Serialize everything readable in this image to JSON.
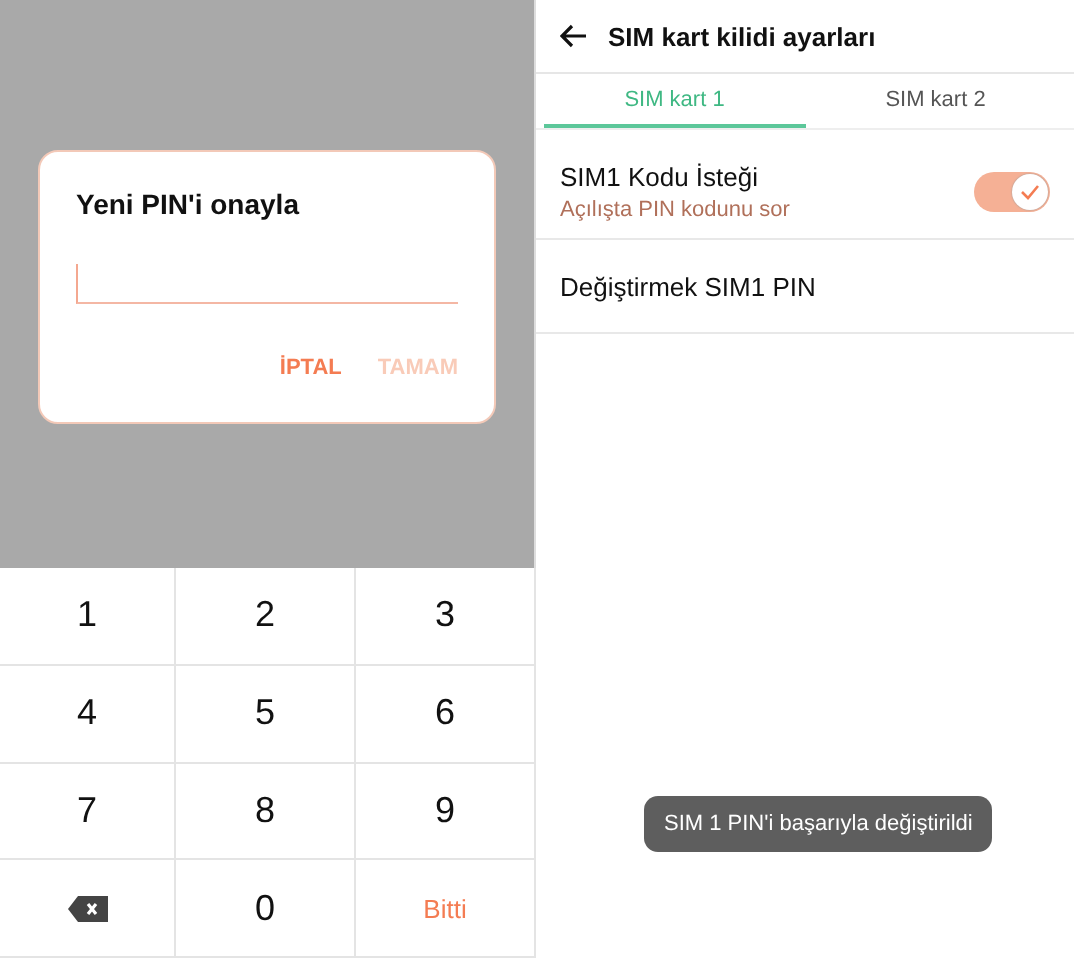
{
  "pin_dialog": {
    "title": "Yeni PIN'i onayla",
    "buttons": [
      {
        "label": "İPTAL",
        "disabled": false
      },
      {
        "label": "TAMAM",
        "disabled": true
      }
    ]
  },
  "keypad": {
    "keys": [
      {
        "kind": "digit",
        "label": "1"
      },
      {
        "kind": "digit",
        "label": "2"
      },
      {
        "kind": "digit",
        "label": "3"
      },
      {
        "kind": "digit",
        "label": "4"
      },
      {
        "kind": "digit",
        "label": "5"
      },
      {
        "kind": "digit",
        "label": "6"
      },
      {
        "kind": "digit",
        "label": "7"
      },
      {
        "kind": "digit",
        "label": "8"
      },
      {
        "kind": "digit",
        "label": "9"
      },
      {
        "kind": "backspace"
      },
      {
        "kind": "digit",
        "label": "0"
      },
      {
        "kind": "done",
        "label": "Bitti"
      }
    ]
  },
  "settings": {
    "title": "SIM kart kilidi ayarları",
    "tabs": [
      {
        "label": "SIM kart 1",
        "selected": true
      },
      {
        "label": "SIM kart 2",
        "selected": false
      }
    ],
    "rows": [
      {
        "kind": "toggle",
        "title": "SIM1 Kodu İsteği",
        "subtitle": "Açılışta PIN kodunu sor",
        "on": true
      },
      {
        "kind": "link",
        "title": "Değiştirmek SIM1 PIN"
      }
    ]
  },
  "toast": {
    "text": "SIM 1 PIN'i başarıyla değiştirildi"
  }
}
